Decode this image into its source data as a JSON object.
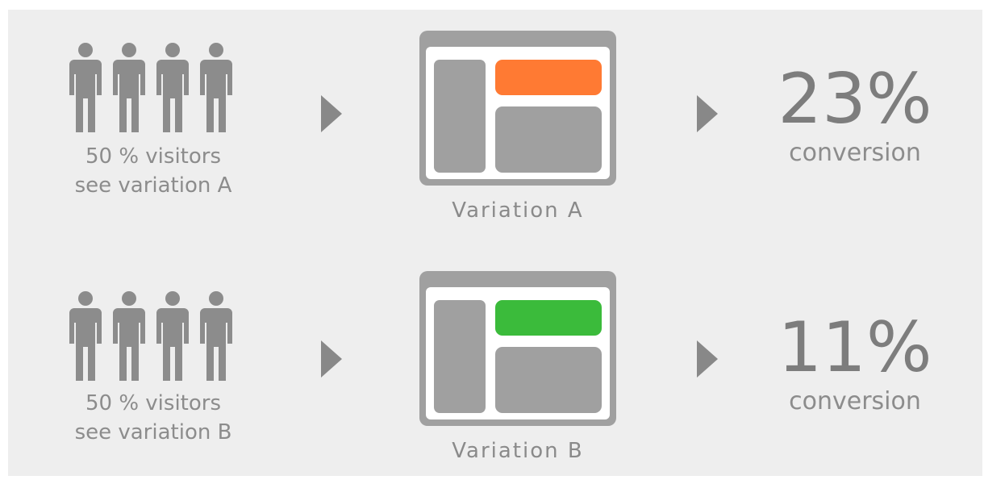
{
  "colors": {
    "background": "#eeeeee",
    "icon_gray": "#8c8c8c",
    "block_gray": "#a0a0a0",
    "variation_a_accent": "#ff7a33",
    "variation_b_accent": "#3bbb3b"
  },
  "rows": [
    {
      "people_icon_count": 4,
      "visitor_line1": "50 % visitors",
      "visitor_line2": "see variation A",
      "variation_label": "Variation A",
      "accent_icon": "orange-block-icon",
      "percent": "23%",
      "conversion": "conversion"
    },
    {
      "people_icon_count": 4,
      "visitor_line1": "50 % visitors",
      "visitor_line2": "see variation B",
      "variation_label": "Variation B",
      "accent_icon": "green-block-icon",
      "percent": "11%",
      "conversion": "conversion"
    }
  ]
}
